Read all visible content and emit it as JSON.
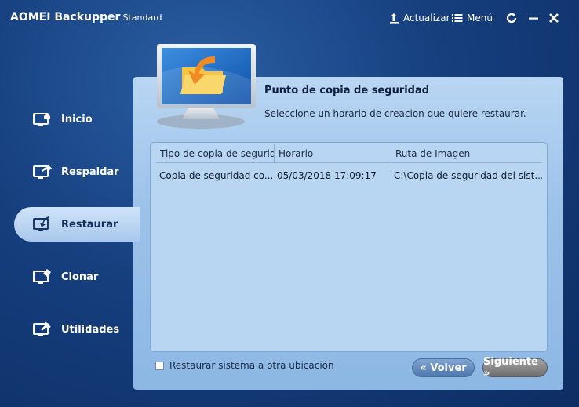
{
  "app": {
    "name": "AOMEI Backupper",
    "edition": "Standard"
  },
  "titlebar": {
    "update_label": "Actualizar",
    "menu_label": "Menú"
  },
  "sidebar": {
    "items": [
      {
        "label": "Inicio",
        "icon": "home-monitor-icon",
        "active": false
      },
      {
        "label": "Respaldar",
        "icon": "backup-monitor-icon",
        "active": false
      },
      {
        "label": "Restaurar",
        "icon": "restore-monitor-icon",
        "active": true
      },
      {
        "label": "Clonar",
        "icon": "clone-monitor-icon",
        "active": false
      },
      {
        "label": "Utilidades",
        "icon": "tools-monitor-icon",
        "active": false
      }
    ]
  },
  "panel": {
    "title": "Punto de copia de seguridad",
    "subtitle": "Seleccione un horario de creacion que quiere restaurar."
  },
  "table": {
    "columns": [
      "Tipo de copia de seguridad",
      "Horario",
      "Ruta de Imagen"
    ],
    "rows": [
      [
        "Copia de seguridad co...",
        "05/03/2018 17:09:17",
        "C:\\Copia de seguridad del sist..."
      ]
    ]
  },
  "footer": {
    "checkbox_label": "Restaurar sistema a otra ubicación",
    "checkbox_checked": false,
    "back_label": "« Volver",
    "next_label": "Siguiente »"
  },
  "colors": {
    "background": "#163f7e",
    "panel": "#9ec3ea",
    "active_nav": "#cfe3f8"
  }
}
